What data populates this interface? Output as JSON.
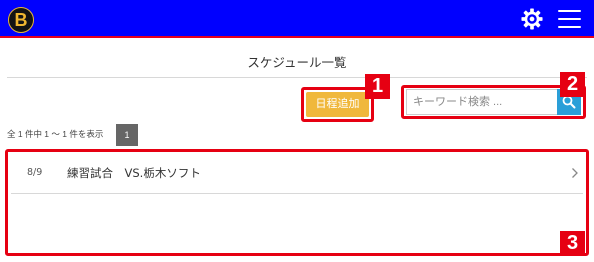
{
  "header": {
    "logo_letter": "B",
    "bg_color": "#0000ff",
    "accent_color": "#e6001f",
    "icons": [
      "gear-icon",
      "hamburger-menu-icon"
    ]
  },
  "page": {
    "title": "スケジュール一覧"
  },
  "toolbar": {
    "add_label": "日程追加",
    "add_color": "#f0b83c"
  },
  "search": {
    "placeholder": "キーワード検索 ...",
    "value": "",
    "button_color": "#2a9fd8"
  },
  "pagination": {
    "summary": "全 1 件中 1 ～ 1 件を表示",
    "pages": [
      "1"
    ]
  },
  "schedule": {
    "items": [
      {
        "date": "8/9",
        "title": "練習試合　VS.栃木ソフト"
      }
    ]
  },
  "annotations": {
    "color": "#e60012",
    "labels": [
      "1",
      "2",
      "3"
    ]
  }
}
